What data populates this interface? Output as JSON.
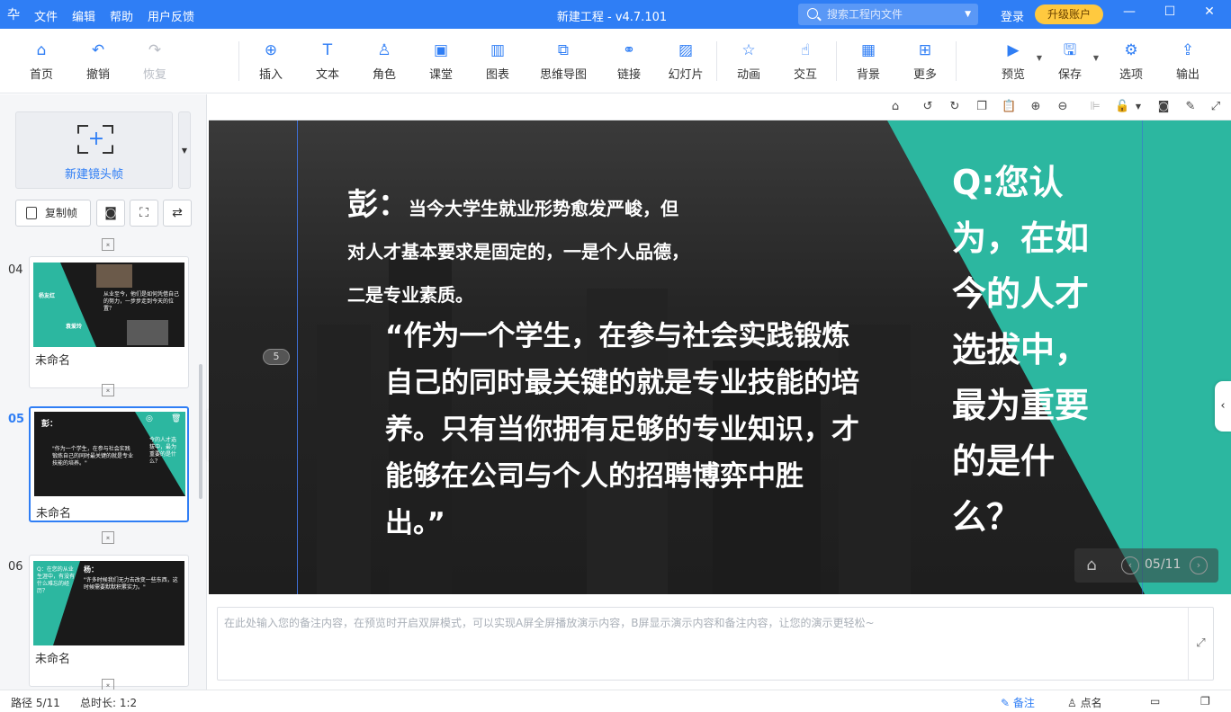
{
  "titlebar": {
    "logo": "卆",
    "menu": [
      "文件",
      "编辑",
      "帮助",
      "用户反馈"
    ],
    "title": "新建工程 - v4.7.101",
    "search_placeholder": "搜索工程内文件",
    "login": "登录",
    "upgrade": "升级账户"
  },
  "toolbar": {
    "home": "首页",
    "undo": "撤销",
    "redo": "恢复",
    "insert": "插入",
    "text": "文本",
    "role": "角色",
    "classroom": "课堂",
    "chart": "图表",
    "mindmap": "思维导图",
    "link": "链接",
    "slides": "幻灯片",
    "animation": "动画",
    "interaction": "交互",
    "background": "背景",
    "more": "更多",
    "preview": "预览",
    "save": "保存",
    "options": "选项",
    "export": "输出"
  },
  "leftpanel": {
    "new_frame": "新建镜头帧",
    "copy_frame": "复制帧",
    "frames": [
      {
        "number": "04",
        "name": "未命名",
        "thumb": {
          "name_left": "杨友红",
          "question": "从业至今，他们是如何凭借自己的努力，一步步走到今天的位置？",
          "name_right": "袁爱玲"
        }
      },
      {
        "number": "05",
        "name": "未命名",
        "active": true,
        "thumb": {
          "speaker": "彭：",
          "body": "\"作为一个学生，在参与社会实践锻炼自己的同时最关键的就是专业技能的培养。\"",
          "question": "今的人才选拔中，最为重要的是什么？"
        }
      },
      {
        "number": "06",
        "name": "未命名",
        "thumb": {
          "question": "Q：在您的从业生涯中，有没有什么难忘的经历？",
          "speaker": "杨：",
          "body": "\"许多时候我们无力去改变一些东西，这时候需要默默积累实力。\""
        }
      }
    ]
  },
  "stage": {
    "guide_badge": "5",
    "speaker_name": "彭：",
    "speaker_text": "当今大学生就业形势愈发严峻，但对人才基本要求是固定的，一是个人品德，二是专业素质。",
    "quote": "“作为一个学生，在参与社会实践锻炼自己的同时最关键的就是专业技能的培养。只有当你拥有足够的专业知识，才能够在公司与个人的招聘博弈中胜出。”",
    "question": "Q:您认为，在如今的人才选拔中，最为重要的是什么？",
    "pager": "05/11",
    "colors": {
      "teal": "#2cb7a0",
      "dark": "#2b2b2b",
      "accent": "#2f7ef5"
    }
  },
  "notes": {
    "placeholder": "在此处输入您的备注内容，在预览时开启双屏模式，可以实现A屏全屏播放演示内容，B屏显示演示内容和备注内容，让您的演示更轻松~"
  },
  "statusbar": {
    "path": "路径 5/11",
    "duration": "总时长: 1:2",
    "notes": "备注",
    "rollcall": "点名"
  }
}
